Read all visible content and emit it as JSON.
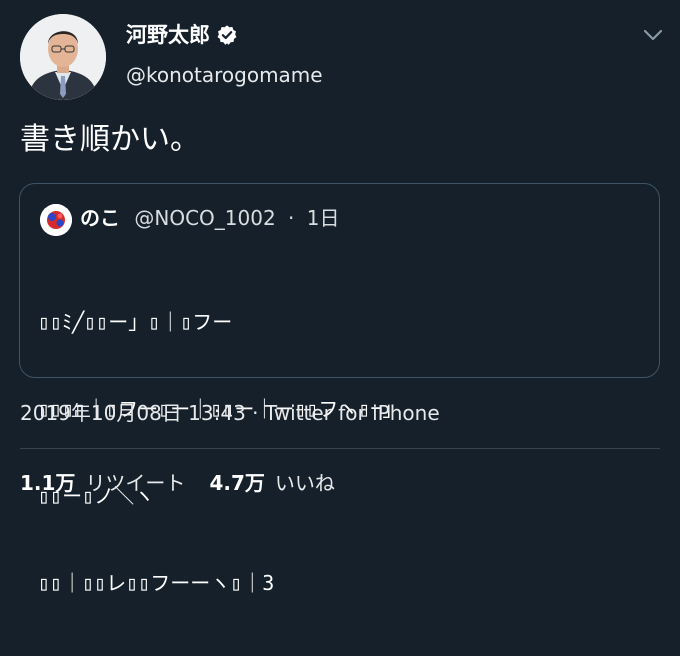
{
  "tweet": {
    "author": {
      "display_name": "河野太郎",
      "handle": "@konotarogomame",
      "verified": true,
      "avatar_icon": "person-portrait-icon"
    },
    "menu_icon": "chevron-down-icon",
    "text": "書き順かい。",
    "quote": {
      "name": "のこ",
      "handle": "@NOCO_1002",
      "separator": "·",
      "time": "1日",
      "avatar_icon": "red-blue-dots-avatar-icon",
      "lines": [
        "▯▯ﾐ╱▯▯ー」▯｜▯フー",
        "▯▯▯▯｜▯フー▯ー｜▯▯ー｜ー▯▯フヽ▯¬」",
        "▯▯ー▯ノ＼ヽ",
        "▯▯｜▯▯レ▯▯フーーヽ▯｜3"
      ]
    },
    "meta": {
      "date": "2019年10月08日 13:43",
      "separator": "·",
      "client": "Twitter for iPhone"
    },
    "stats": {
      "retweets_count": "1.1万",
      "retweets_label": "リツイート",
      "likes_count": "4.7万",
      "likes_label": "いいね"
    }
  },
  "colors": {
    "background": "#15202b",
    "border": "#3d5466",
    "divider": "#38444d",
    "text": "#ffffff"
  }
}
